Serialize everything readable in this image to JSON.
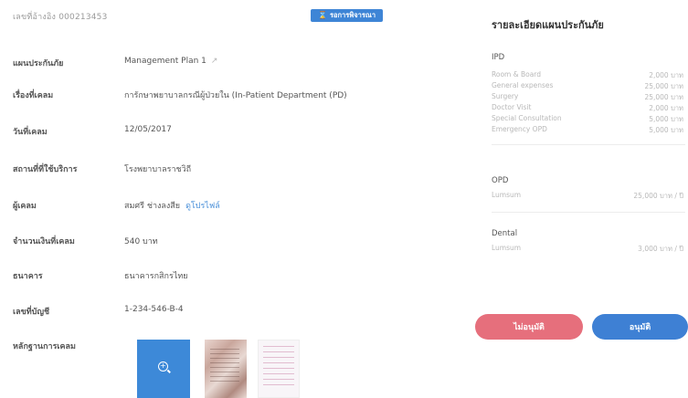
{
  "header": {
    "reference": "เลขที่อ้างอิง 000213453",
    "status_badge": "รอการพิจารณา"
  },
  "claim_fields": [
    {
      "label": "แผนประกันภัย",
      "value": "Management Plan 1"
    },
    {
      "label": "เรื่องที่เคลม",
      "value": "การักษาพยาบาลกรณีผู้ป่วยใน (In-Patient Department (PD)"
    },
    {
      "label": "วันที่เคลม",
      "value": "12/05/2017"
    },
    {
      "label": "สถานที่ที่ใช้บริการ",
      "value": "โรงพยาบาลราชวิถี"
    },
    {
      "label": "ผู้เคลม",
      "value": "สมศรี ช่างลงสีย",
      "link": "ดูโปรไฟล์"
    },
    {
      "label": "จำนวนเงินที่เคลม",
      "value": "540 บาท"
    },
    {
      "label": "ธนาคาร",
      "value": "ธนาคารกสิกรไทย"
    },
    {
      "label": "เลขที่บัญชี",
      "value": "1-234-546-B-4"
    },
    {
      "label": "หลักฐานการเคลม",
      "value": ""
    }
  ],
  "evidence": {
    "icons": [
      "zoom-icon"
    ]
  },
  "plan_details": {
    "title": "รายละเอียดแผนประกันภัย",
    "ipd": {
      "heading": "IPD",
      "items": [
        {
          "name": "Room & Board",
          "amount": "2,000 บาท"
        },
        {
          "name": "General expenses",
          "amount": "25,000 บาท"
        },
        {
          "name": "Surgery",
          "amount": "25,000 บาท"
        },
        {
          "name": "Doctor Visit",
          "amount": "2,000 บาท"
        },
        {
          "name": "Special Consultation",
          "amount": "5,000 บาท"
        },
        {
          "name": "Emergency OPD",
          "amount": "5,000 บาท"
        }
      ]
    },
    "opd": {
      "heading": "OPD",
      "items": [
        {
          "name": "Lumsum",
          "amount": "25,000 บาท / ปี"
        }
      ]
    },
    "dental": {
      "heading": "Dental",
      "items": [
        {
          "name": "Lumsum",
          "amount": "3,000 บาท / ปี"
        }
      ]
    }
  },
  "actions": {
    "reject_label": "ไม่อนุมัติ",
    "approve_label": "อนุมัติ"
  },
  "colors": {
    "accent_blue": "#3e80d4",
    "reject_pink": "#e66f7c",
    "badge_blue": "#3e85d6"
  }
}
